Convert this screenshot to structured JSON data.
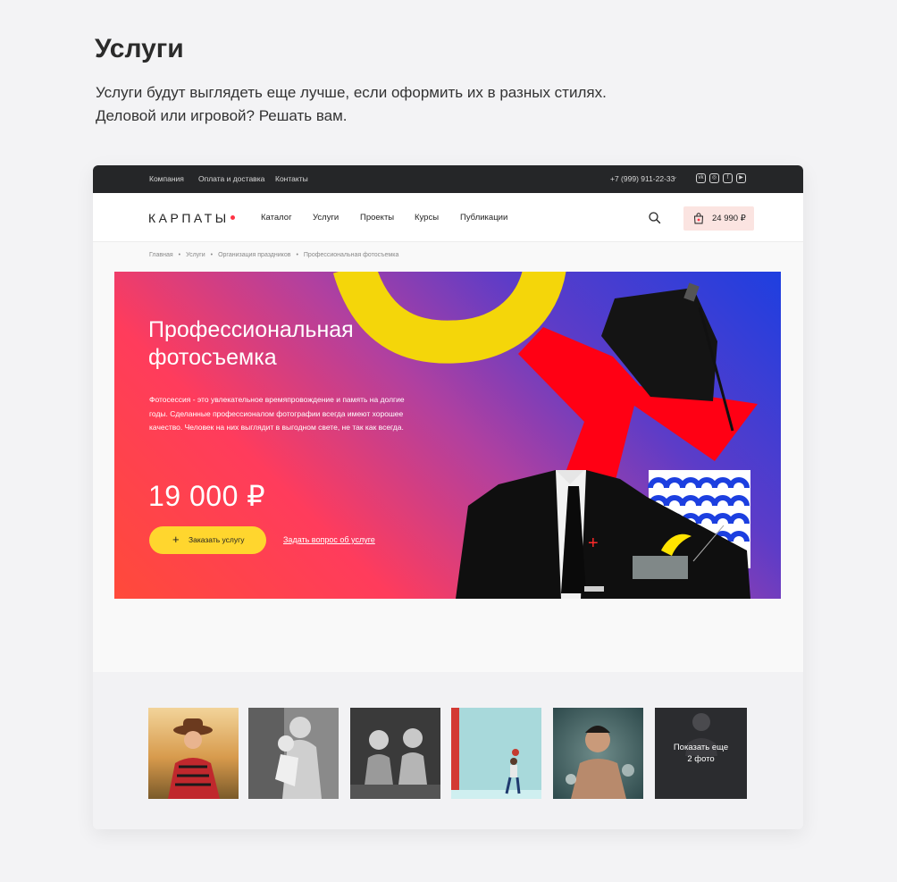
{
  "page": {
    "title": "Услуги",
    "description_line1": "Услуги будут выглядеть еще лучше, если оформить их в разных стилях.",
    "description_line2": "Деловой или игровой? Решать вам."
  },
  "topbar": {
    "links": [
      "Компания",
      "Оплата и доставка",
      "Контакты"
    ],
    "phone": "+7 (999) 911-22-33",
    "social_icons": [
      "vk-icon",
      "instagram-icon",
      "facebook-icon",
      "youtube-icon"
    ]
  },
  "nav": {
    "logo": "КАРПАТЫ",
    "items": [
      "Каталог",
      "Услуги",
      "Проекты",
      "Курсы",
      "Публикации"
    ],
    "cart_total": "24 990 ₽"
  },
  "breadcrumbs": [
    "Главная",
    "Услуги",
    "Организация праздников",
    "Профессиональная фотосъемка"
  ],
  "hero": {
    "title_line1": "Профессиональная",
    "title_line2": "фотосъемка",
    "text_line1": "Фотосессия - это увлекательное времяпровождение и память на долгие",
    "text_line2": "годы. Сделанные профессионалом фотографии всегда имеют хорошее",
    "text_line3": "качество. Человек на них выглядит в выгодном свете, не так как всегда.",
    "price": "19 000 ₽",
    "order_button": "Заказать услугу",
    "ask_link": "Задать вопрос об услуге"
  },
  "gallery": {
    "thumbnails": [
      "photo-woman-hat-field",
      "photo-mother-child-bw",
      "photo-two-girls-bw",
      "photo-child-lifted-teal",
      "photo-man-water"
    ],
    "more_line1": "Показать еще",
    "more_line2": "2 фото"
  },
  "colors": {
    "topbar_bg": "#252628",
    "accent_red": "#ff3344",
    "button_yellow": "#ffd62e",
    "cart_bg": "#fbe4e1"
  }
}
